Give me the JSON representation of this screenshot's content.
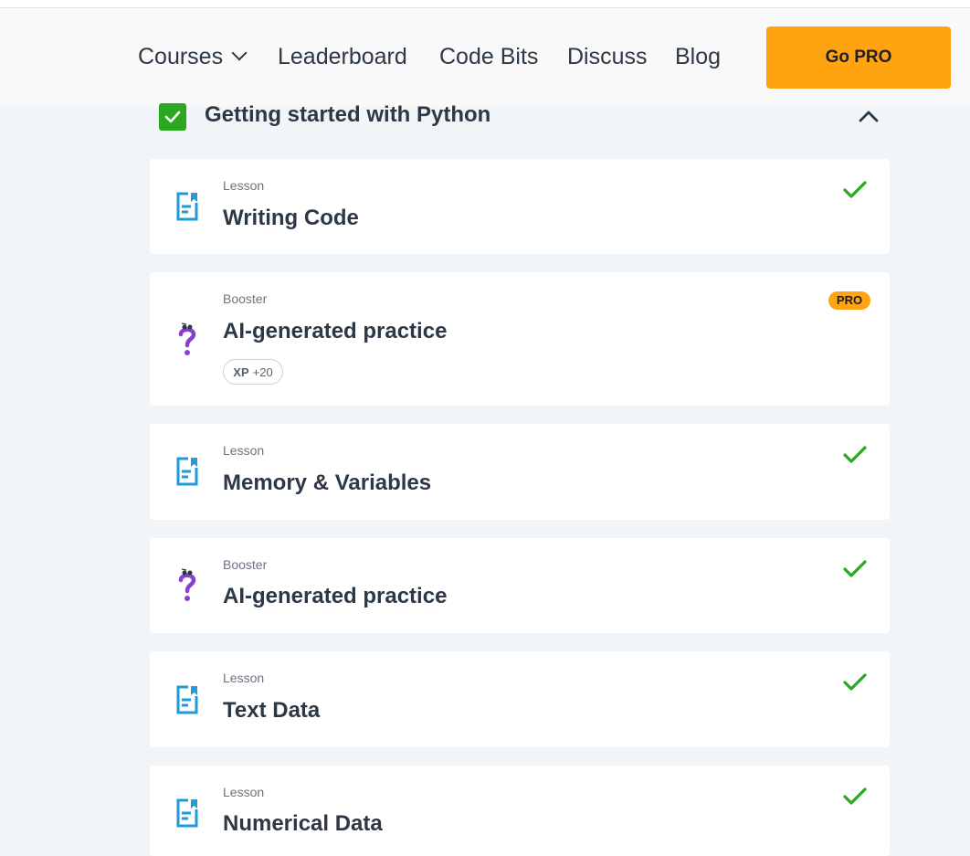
{
  "nav": {
    "courses": "Courses",
    "leaderboard": "Leaderboard",
    "code_bits": "Code Bits",
    "discuss": "Discuss",
    "blog": "Blog",
    "go_pro": "Go PRO"
  },
  "section": {
    "title": "Getting started with Python",
    "completed": true
  },
  "items": [
    {
      "type": "Lesson",
      "title": "Writing Code",
      "icon": "document-icon",
      "completed": true
    },
    {
      "type": "Booster",
      "title": "AI-generated practice",
      "icon": "question-mark-icon",
      "badge": "PRO",
      "xp_label": "XP",
      "xp_value": "+20",
      "completed": false
    },
    {
      "type": "Lesson",
      "title": "Memory & Variables",
      "icon": "document-icon",
      "completed": true
    },
    {
      "type": "Booster",
      "title": "AI-generated practice",
      "icon": "question-mark-icon",
      "completed": true
    },
    {
      "type": "Lesson",
      "title": "Text Data",
      "icon": "document-icon",
      "completed": true
    },
    {
      "type": "Lesson",
      "title": "Numerical Data",
      "icon": "document-icon",
      "completed": true
    }
  ],
  "colors": {
    "accent": "#ffa310",
    "success": "#2aa820",
    "lesson_icon": "#1d9bdb",
    "booster_icon": "#8a3fd0"
  }
}
